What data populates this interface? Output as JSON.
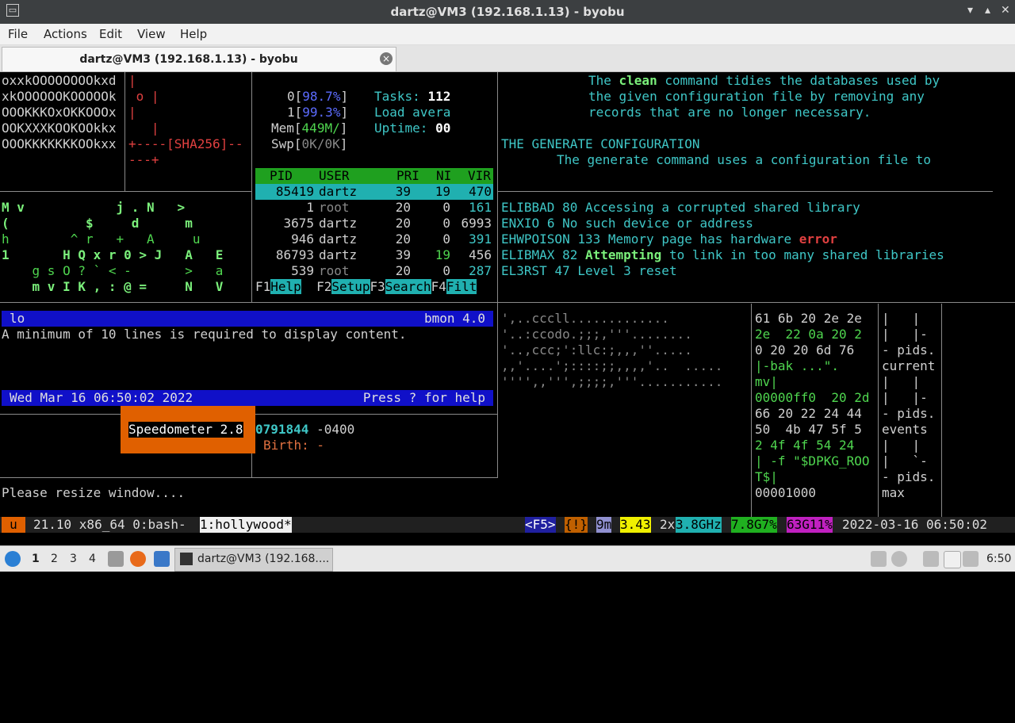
{
  "window": {
    "title": "dartz@VM3 (192.168.1.13) - byobu",
    "min": "▾",
    "max": "▴",
    "close": "✕"
  },
  "menu": [
    "File",
    "Actions",
    "Edit",
    "View",
    "Help"
  ],
  "tab": {
    "label": "dartz@VM3 (192.168.1.13) - byobu"
  },
  "randomart": [
    "oxxkOOOOOOOOkxd",
    "xkOOOOOOKOOOOOk",
    "OOOKKKOxOKKOOOx",
    "OOKXXXKOOKOOkkx",
    "OOOKKKKKKKOOkxx"
  ],
  "sha_art": [
    "|",
    " o |",
    "|",
    "   |",
    "+----[SHA256]--",
    "---+"
  ],
  "htop": {
    "cpu0": "0",
    "cpu0_val": "98.7%",
    "cpu1": "1",
    "cpu1_val": "99.3%",
    "mem_label": "Mem",
    "mem_val": "449M/",
    "swp_label": "Swp",
    "swp_val": "0K/0K",
    "tasks_label": "Tasks:",
    "tasks": "112",
    "load_label": "Load avera",
    "uptime_label": "Uptime:",
    "uptime": "00",
    "columns": [
      "PID",
      "USER",
      "PRI",
      "NI",
      "VIR"
    ],
    "rows": [
      [
        "85419",
        "dartz",
        "39",
        "19",
        "470"
      ],
      [
        "1",
        "root",
        "20",
        "0",
        "161"
      ],
      [
        "3675",
        "dartz",
        "20",
        "0",
        "6993"
      ],
      [
        "946",
        "dartz",
        "20",
        "0",
        "391"
      ],
      [
        "86793",
        "dartz",
        "39",
        "19",
        "456"
      ],
      [
        "539",
        "root",
        "20",
        "0",
        "287"
      ]
    ],
    "fkeys": [
      [
        "F1",
        "Help"
      ],
      [
        "F2",
        "Setup"
      ],
      [
        "F3",
        "Search"
      ],
      [
        "F4",
        "Filt"
      ]
    ]
  },
  "matrix": [
    "M v            j . N   >",
    "(          $     d      m",
    "h        ^ r   +   A     u",
    "1       H Q x r 0 > J   A   E",
    "    g s O ? ` < -       >   a",
    "    m v I K , : @ =     N   V"
  ],
  "docs": {
    "clean_pre": "The ",
    "clean_cmd": "clean",
    "clean_post": " command tidies the databases used by",
    "line2": "the given configuration file by removing any",
    "line3": "records that are no longer necessary.",
    "heading": "THE GENERATE CONFIGURATION",
    "line5": "The generate command uses a configuration file to"
  },
  "errors": [
    {
      "name": "ELIBBAD",
      "num": "80",
      "msg": "Accessing a corrupted shared library"
    },
    {
      "name": "ENXIO",
      "num": "6",
      "msg": "No such device or address"
    },
    {
      "name": "EHWPOISON",
      "num": "133",
      "msg": "Memory page has hardware ",
      "hl": "error"
    },
    {
      "name": "ELIBMAX",
      "num": "82",
      "hl2": "Attempting",
      "msg": " to link in too many shared libraries"
    },
    {
      "name": "EL3RST",
      "num": "47",
      "msg": "Level 3 reset"
    }
  ],
  "bmon": {
    "iface": "lo",
    "version": "bmon 4.0",
    "message": "A minimum of 10 lines is required to display content.",
    "date": "Wed Mar 16 06:50:02 2022",
    "help": "Press ? for help"
  },
  "speedometer": {
    "label": "Speedometer 2.8",
    "num": "0791844",
    "tz": "-0400",
    "birth": "Birth: -"
  },
  "resize": "Please resize window....",
  "ascii": [
    "',..cccll.............",
    "'..:ccodo.;;;,'''........",
    "'..,ccc;':llc:;,,,''.....",
    ",,'....';::::;;,,,,'..  .....",
    "'''',,''',;;;;,'''..........."
  ],
  "hex": [
    "61 6b 20 2e 2e",
    "2e  22 0a 20 2",
    "0 20 20 6d 76",
    "|-bak ...\".",
    "mv|",
    "00000ff0  20 2d",
    "66 20 22 24 44",
    "50  4b 47 5f 5",
    "2 4f 4f 54 24",
    "| -f \"$DPKG_ROO",
    "T$|",
    "00001000"
  ],
  "tree": [
    "|   |",
    "|   |-",
    "- pids.",
    "current",
    "|   |",
    "|   |-",
    "- pids.",
    "events",
    "|   |",
    "|   `-",
    "- pids.",
    "max"
  ],
  "status": {
    "u": "u",
    "version": "21.10 x86_64 0:bash-",
    "window": "1:hollywood*",
    "f5": "<F5>",
    "excl": "{!}",
    "mem": "9m",
    "load": "3.43",
    "cores": "2x",
    "ghz": "3.8GHz",
    "mem2": "7.8G7%",
    "disk": "63G11%",
    "clock": "2022-03-16 06:50:02"
  },
  "taskbar": {
    "workspaces": [
      "1",
      "2",
      "3",
      "4"
    ],
    "app": "dartz@VM3 (192.168....",
    "time": "6:50"
  }
}
